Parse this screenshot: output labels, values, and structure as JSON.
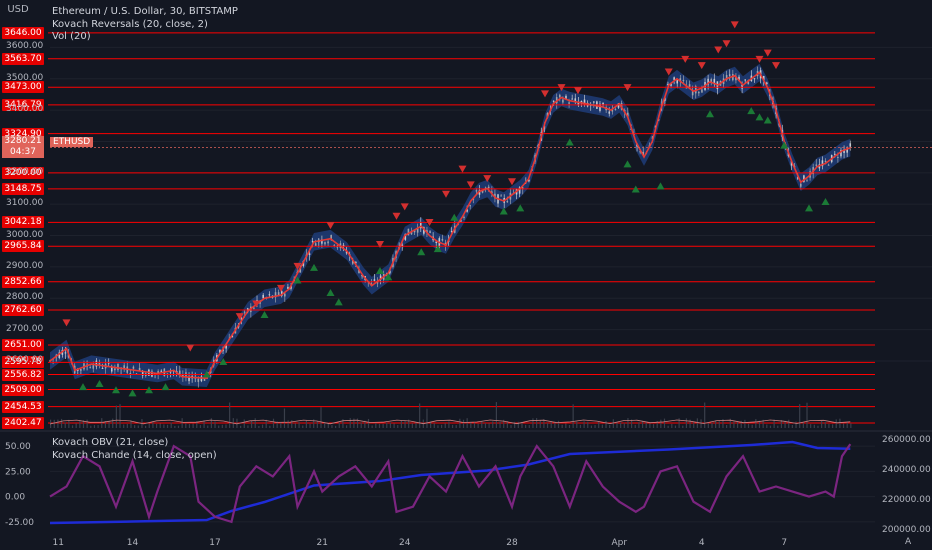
{
  "header": {
    "currency": "USD",
    "legend_main": "Ethereum / U.S. Dollar, 30, BITSTAMP",
    "legend_kovach_reversals": "Kovach Reversals (20, close, 2)",
    "legend_vol": "Vol (20)",
    "legend_obv": "Kovach OBV (21, close)",
    "legend_chande": "Kovach Chande (14, close, open)"
  },
  "current_price": {
    "value": "3280.21",
    "countdown": "04:37",
    "symbol": "ETHUSD"
  },
  "colors": {
    "background": "#131722",
    "level_line": "#ff0000",
    "bull": "#26a69a",
    "bear": "#ef5350",
    "obv": "#1e2bd6",
    "chande": "#7b2580",
    "band": "#1f3c78"
  },
  "chart_data": [
    {
      "type": "line",
      "title": "Ethereum / U.S. Dollar, 30, BITSTAMP",
      "x": [
        "11",
        "14",
        "17",
        "21",
        "24",
        "28",
        "Apr",
        "4",
        "7"
      ],
      "y_ticks": [
        "3600.00",
        "3500.00",
        "3400.00",
        "3300.00",
        "3200.00",
        "3100.00",
        "3000.00",
        "2900.00",
        "2800.00",
        "2700.00",
        "2600.00"
      ],
      "ylim": [
        2380,
        3700
      ],
      "levels": [
        "3646.00",
        "3563.70",
        "3473.00",
        "3416.79",
        "3324.90",
        "3200.00",
        "3148.75",
        "3042.18",
        "2965.84",
        "2852.66",
        "2762.60",
        "2651.00",
        "2595.78",
        "2556.82",
        "2509.00",
        "2454.53",
        "2402.47"
      ],
      "close_path": [
        {
          "x": 0.0,
          "y": 2600
        },
        {
          "x": 0.02,
          "y": 2640
        },
        {
          "x": 0.03,
          "y": 2570
        },
        {
          "x": 0.05,
          "y": 2590
        },
        {
          "x": 0.09,
          "y": 2575
        },
        {
          "x": 0.13,
          "y": 2560
        },
        {
          "x": 0.15,
          "y": 2570
        },
        {
          "x": 0.16,
          "y": 2550
        },
        {
          "x": 0.19,
          "y": 2545
        },
        {
          "x": 0.2,
          "y": 2600
        },
        {
          "x": 0.21,
          "y": 2640
        },
        {
          "x": 0.22,
          "y": 2680
        },
        {
          "x": 0.23,
          "y": 2720
        },
        {
          "x": 0.24,
          "y": 2760
        },
        {
          "x": 0.26,
          "y": 2800
        },
        {
          "x": 0.28,
          "y": 2810
        },
        {
          "x": 0.29,
          "y": 2830
        },
        {
          "x": 0.3,
          "y": 2880
        },
        {
          "x": 0.31,
          "y": 2930
        },
        {
          "x": 0.32,
          "y": 2980
        },
        {
          "x": 0.34,
          "y": 2990
        },
        {
          "x": 0.36,
          "y": 2950
        },
        {
          "x": 0.38,
          "y": 2870
        },
        {
          "x": 0.39,
          "y": 2840
        },
        {
          "x": 0.41,
          "y": 2880
        },
        {
          "x": 0.42,
          "y": 2940
        },
        {
          "x": 0.43,
          "y": 3000
        },
        {
          "x": 0.45,
          "y": 3030
        },
        {
          "x": 0.46,
          "y": 3000
        },
        {
          "x": 0.47,
          "y": 2980
        },
        {
          "x": 0.48,
          "y": 2970
        },
        {
          "x": 0.49,
          "y": 3020
        },
        {
          "x": 0.5,
          "y": 3060
        },
        {
          "x": 0.51,
          "y": 3110
        },
        {
          "x": 0.52,
          "y": 3140
        },
        {
          "x": 0.53,
          "y": 3150
        },
        {
          "x": 0.54,
          "y": 3120
        },
        {
          "x": 0.55,
          "y": 3110
        },
        {
          "x": 0.56,
          "y": 3130
        },
        {
          "x": 0.57,
          "y": 3150
        },
        {
          "x": 0.58,
          "y": 3180
        },
        {
          "x": 0.59,
          "y": 3260
        },
        {
          "x": 0.6,
          "y": 3360
        },
        {
          "x": 0.61,
          "y": 3420
        },
        {
          "x": 0.62,
          "y": 3440
        },
        {
          "x": 0.63,
          "y": 3430
        },
        {
          "x": 0.65,
          "y": 3420
        },
        {
          "x": 0.67,
          "y": 3410
        },
        {
          "x": 0.68,
          "y": 3400
        },
        {
          "x": 0.69,
          "y": 3420
        },
        {
          "x": 0.7,
          "y": 3380
        },
        {
          "x": 0.71,
          "y": 3300
        },
        {
          "x": 0.72,
          "y": 3250
        },
        {
          "x": 0.73,
          "y": 3300
        },
        {
          "x": 0.74,
          "y": 3400
        },
        {
          "x": 0.75,
          "y": 3480
        },
        {
          "x": 0.76,
          "y": 3500
        },
        {
          "x": 0.77,
          "y": 3480
        },
        {
          "x": 0.78,
          "y": 3460
        },
        {
          "x": 0.79,
          "y": 3470
        },
        {
          "x": 0.8,
          "y": 3490
        },
        {
          "x": 0.81,
          "y": 3480
        },
        {
          "x": 0.82,
          "y": 3500
        },
        {
          "x": 0.83,
          "y": 3510
        },
        {
          "x": 0.84,
          "y": 3480
        },
        {
          "x": 0.85,
          "y": 3500
        },
        {
          "x": 0.86,
          "y": 3520
        },
        {
          "x": 0.87,
          "y": 3470
        },
        {
          "x": 0.88,
          "y": 3400
        },
        {
          "x": 0.89,
          "y": 3300
        },
        {
          "x": 0.9,
          "y": 3230
        },
        {
          "x": 0.91,
          "y": 3170
        },
        {
          "x": 0.92,
          "y": 3190
        },
        {
          "x": 0.93,
          "y": 3220
        },
        {
          "x": 0.94,
          "y": 3230
        },
        {
          "x": 0.95,
          "y": 3250
        },
        {
          "x": 0.96,
          "y": 3270
        },
        {
          "x": 0.97,
          "y": 3280
        }
      ],
      "sell_arrows": [
        {
          "x": 0.02,
          "y": 2720
        },
        {
          "x": 0.17,
          "y": 2640
        },
        {
          "x": 0.23,
          "y": 2740
        },
        {
          "x": 0.25,
          "y": 2780
        },
        {
          "x": 0.28,
          "y": 2830
        },
        {
          "x": 0.3,
          "y": 2900
        },
        {
          "x": 0.34,
          "y": 3030
        },
        {
          "x": 0.4,
          "y": 2970
        },
        {
          "x": 0.42,
          "y": 3060
        },
        {
          "x": 0.43,
          "y": 3090
        },
        {
          "x": 0.46,
          "y": 3040
        },
        {
          "x": 0.48,
          "y": 3130
        },
        {
          "x": 0.5,
          "y": 3210
        },
        {
          "x": 0.51,
          "y": 3160
        },
        {
          "x": 0.53,
          "y": 3180
        },
        {
          "x": 0.56,
          "y": 3170
        },
        {
          "x": 0.6,
          "y": 3450
        },
        {
          "x": 0.62,
          "y": 3470
        },
        {
          "x": 0.64,
          "y": 3460
        },
        {
          "x": 0.7,
          "y": 3470
        },
        {
          "x": 0.75,
          "y": 3520
        },
        {
          "x": 0.77,
          "y": 3560
        },
        {
          "x": 0.79,
          "y": 3540
        },
        {
          "x": 0.81,
          "y": 3590
        },
        {
          "x": 0.82,
          "y": 3610
        },
        {
          "x": 0.83,
          "y": 3670
        },
        {
          "x": 0.86,
          "y": 3560
        },
        {
          "x": 0.87,
          "y": 3580
        },
        {
          "x": 0.88,
          "y": 3540
        }
      ],
      "buy_arrows": [
        {
          "x": 0.04,
          "y": 2520
        },
        {
          "x": 0.06,
          "y": 2530
        },
        {
          "x": 0.08,
          "y": 2510
        },
        {
          "x": 0.1,
          "y": 2500
        },
        {
          "x": 0.12,
          "y": 2510
        },
        {
          "x": 0.14,
          "y": 2520
        },
        {
          "x": 0.19,
          "y": 2560
        },
        {
          "x": 0.21,
          "y": 2600
        },
        {
          "x": 0.26,
          "y": 2750
        },
        {
          "x": 0.3,
          "y": 2860
        },
        {
          "x": 0.32,
          "y": 2900
        },
        {
          "x": 0.34,
          "y": 2820
        },
        {
          "x": 0.35,
          "y": 2790
        },
        {
          "x": 0.4,
          "y": 2890
        },
        {
          "x": 0.41,
          "y": 2870
        },
        {
          "x": 0.45,
          "y": 2950
        },
        {
          "x": 0.47,
          "y": 2960
        },
        {
          "x": 0.49,
          "y": 3060
        },
        {
          "x": 0.55,
          "y": 3080
        },
        {
          "x": 0.57,
          "y": 3090
        },
        {
          "x": 0.63,
          "y": 3300
        },
        {
          "x": 0.7,
          "y": 3230
        },
        {
          "x": 0.71,
          "y": 3150
        },
        {
          "x": 0.74,
          "y": 3160
        },
        {
          "x": 0.8,
          "y": 3390
        },
        {
          "x": 0.85,
          "y": 3400
        },
        {
          "x": 0.86,
          "y": 3380
        },
        {
          "x": 0.87,
          "y": 3370
        },
        {
          "x": 0.89,
          "y": 3290
        },
        {
          "x": 0.92,
          "y": 3090
        },
        {
          "x": 0.94,
          "y": 3110
        }
      ]
    },
    {
      "type": "line",
      "title": "Kovach OBV (21, close) / Kovach Chande (14, close, open)",
      "left_ticks": [
        "50.00",
        "25.00",
        "0.00",
        "-25.00"
      ],
      "left_ylim": [
        -35,
        60
      ],
      "right_ticks": [
        "260000.00",
        "240000.00",
        "220000.00",
        "200000.00"
      ],
      "right_ylim": [
        198000,
        262000
      ],
      "series": [
        {
          "name": "Kovach OBV",
          "axis": "right",
          "points": [
            {
              "x": 0.0,
              "y": 204000
            },
            {
              "x": 0.1,
              "y": 205000
            },
            {
              "x": 0.19,
              "y": 206000
            },
            {
              "x": 0.22,
              "y": 212000
            },
            {
              "x": 0.26,
              "y": 218000
            },
            {
              "x": 0.32,
              "y": 229000
            },
            {
              "x": 0.4,
              "y": 232000
            },
            {
              "x": 0.45,
              "y": 236000
            },
            {
              "x": 0.53,
              "y": 239000
            },
            {
              "x": 0.58,
              "y": 243000
            },
            {
              "x": 0.63,
              "y": 250000
            },
            {
              "x": 0.75,
              "y": 253000
            },
            {
              "x": 0.85,
              "y": 256000
            },
            {
              "x": 0.9,
              "y": 258000
            },
            {
              "x": 0.93,
              "y": 254000
            },
            {
              "x": 0.97,
              "y": 253500
            }
          ]
        },
        {
          "name": "Kovach Chande",
          "axis": "left",
          "points": [
            {
              "x": 0.0,
              "y": 0
            },
            {
              "x": 0.02,
              "y": 10
            },
            {
              "x": 0.04,
              "y": 40
            },
            {
              "x": 0.06,
              "y": 30
            },
            {
              "x": 0.08,
              "y": -10
            },
            {
              "x": 0.1,
              "y": 35
            },
            {
              "x": 0.12,
              "y": -20
            },
            {
              "x": 0.13,
              "y": 5
            },
            {
              "x": 0.15,
              "y": 50
            },
            {
              "x": 0.17,
              "y": 40
            },
            {
              "x": 0.18,
              "y": -5
            },
            {
              "x": 0.2,
              "y": -20
            },
            {
              "x": 0.22,
              "y": -25
            },
            {
              "x": 0.23,
              "y": 10
            },
            {
              "x": 0.25,
              "y": 30
            },
            {
              "x": 0.27,
              "y": 20
            },
            {
              "x": 0.29,
              "y": 40
            },
            {
              "x": 0.3,
              "y": -10
            },
            {
              "x": 0.32,
              "y": 25
            },
            {
              "x": 0.33,
              "y": 5
            },
            {
              "x": 0.35,
              "y": 20
            },
            {
              "x": 0.37,
              "y": 30
            },
            {
              "x": 0.39,
              "y": 10
            },
            {
              "x": 0.41,
              "y": 35
            },
            {
              "x": 0.42,
              "y": -15
            },
            {
              "x": 0.44,
              "y": -10
            },
            {
              "x": 0.46,
              "y": 20
            },
            {
              "x": 0.48,
              "y": 5
            },
            {
              "x": 0.5,
              "y": 40
            },
            {
              "x": 0.52,
              "y": 10
            },
            {
              "x": 0.54,
              "y": 30
            },
            {
              "x": 0.56,
              "y": -10
            },
            {
              "x": 0.57,
              "y": 20
            },
            {
              "x": 0.59,
              "y": 50
            },
            {
              "x": 0.61,
              "y": 30
            },
            {
              "x": 0.63,
              "y": -10
            },
            {
              "x": 0.65,
              "y": 35
            },
            {
              "x": 0.67,
              "y": 10
            },
            {
              "x": 0.69,
              "y": -5
            },
            {
              "x": 0.71,
              "y": -15
            },
            {
              "x": 0.72,
              "y": -10
            },
            {
              "x": 0.74,
              "y": 25
            },
            {
              "x": 0.76,
              "y": 30
            },
            {
              "x": 0.78,
              "y": -5
            },
            {
              "x": 0.8,
              "y": -15
            },
            {
              "x": 0.82,
              "y": 20
            },
            {
              "x": 0.84,
              "y": 40
            },
            {
              "x": 0.86,
              "y": 5
            },
            {
              "x": 0.88,
              "y": 10
            },
            {
              "x": 0.9,
              "y": 5
            },
            {
              "x": 0.92,
              "y": 0
            },
            {
              "x": 0.94,
              "y": 5
            },
            {
              "x": 0.95,
              "y": 0
            },
            {
              "x": 0.96,
              "y": 40
            },
            {
              "x": 0.97,
              "y": 52
            }
          ]
        }
      ]
    }
  ]
}
